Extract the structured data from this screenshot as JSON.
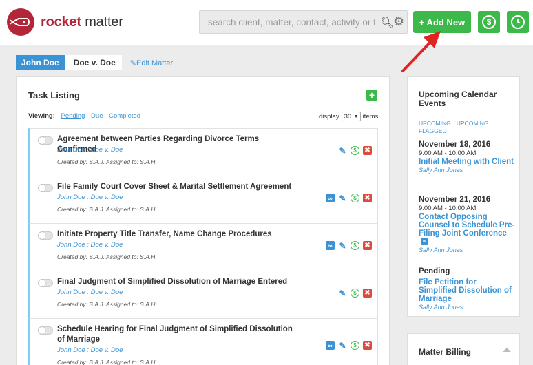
{
  "app": {
    "logo_word1": "rocket",
    "logo_word2": "matter"
  },
  "search": {
    "placeholder": "search client, matter, contact, activity or tag"
  },
  "header": {
    "add_new_label": "+ Add New",
    "billing_icon": "dollar-icon",
    "timer_icon": "clock-icon"
  },
  "breadcrumb": {
    "client": "John Doe",
    "matter": "Doe v. Doe",
    "edit_label": "Edit Matter"
  },
  "tasks": {
    "title": "Task Listing",
    "viewing_label": "Viewing:",
    "filters": [
      "Pending",
      "Due",
      "Completed"
    ],
    "display_label": "display",
    "display_value": "30",
    "items_label": "items",
    "items": [
      {
        "name": "Agreement between Parties Regarding Divorce Terms Confirmed",
        "client": "John Doe : Doe v. Doe",
        "meta": "Created by: S.A.J. Assigned to: S.A.H."
      },
      {
        "name": "File Family Court Cover Sheet & Marital Settlement Agreement",
        "client": "John Doe : Doe v. Doe",
        "meta": "Created by: S.A.J. Assigned to: S.A.H."
      },
      {
        "name": "Initiate Property Title Transfer, Name Change Procedures",
        "client": "John Doe : Doe v. Doe",
        "meta": "Created by: S.A.J. Assigned to: S.A.H."
      },
      {
        "name": "Final Judgment of Simplified Dissolution of Marriage Entered",
        "client": "John Doe : Doe v. Doe",
        "meta": "Created by: S.A.J. Assigned to: S.A.H."
      },
      {
        "name": "Schedule Hearing for Final Judgment of Simplified Dissolution of Marriage",
        "client": "John Doe : Doe v. Doe",
        "meta": "Created by: S.A.J. Assigned to: S.A.H."
      }
    ]
  },
  "calendar": {
    "title": "Upcoming Calendar Events",
    "tab_upcoming": "UPCOMING",
    "tab_flagged": "UPCOMING FLAGGED",
    "events": [
      {
        "date": "November 18, 2016",
        "time": "9:00 AM - 10:00 AM",
        "name": "Initial Meeting with Client",
        "who": "Sally Ann Jones"
      },
      {
        "date": "November 21, 2016",
        "time": "9:00 AM - 10:00 AM",
        "name": "Contact Opposing Counsel to Schedule Pre-Filing Joint Conference",
        "who": "Sally Ann Jones"
      },
      {
        "date": "Pending",
        "time": "",
        "name": "File Petition for Simplified Dissolution of Marriage",
        "who": "Sally Ann Jones"
      }
    ]
  },
  "billing": {
    "title": "Matter Billing"
  },
  "colors": {
    "brand": "#b3263a",
    "accent_blue": "#3a93d5",
    "accent_green": "#3cb94a",
    "delete_red": "#e04a3b",
    "annotation_arrow": "#e02424"
  }
}
